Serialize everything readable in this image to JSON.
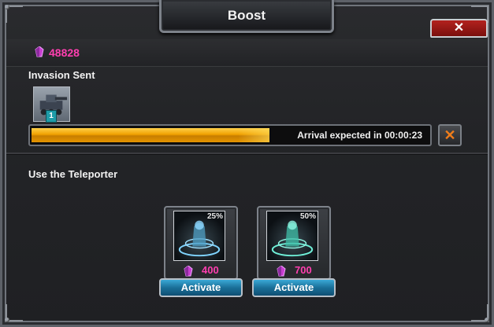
{
  "dialog": {
    "title": "Boost",
    "close_label": "✕"
  },
  "currency": {
    "icon": "crystal-icon",
    "amount": "48828",
    "color": "#ff3fb0"
  },
  "invasion": {
    "label": "Invasion Sent",
    "unit_icon": "tank-unit-icon",
    "unit_count": "1",
    "progress": 0.6,
    "arrival_text": "Arrival expected in 00:00:23",
    "cancel_label": "✕"
  },
  "teleporter": {
    "label": "Use the Teleporter",
    "options": [
      {
        "percent": "25%",
        "cost": "400",
        "button": "Activate",
        "tint": "#7fd4ff"
      },
      {
        "percent": "50%",
        "cost": "700",
        "button": "Activate",
        "tint": "#6ff0d8"
      }
    ]
  }
}
